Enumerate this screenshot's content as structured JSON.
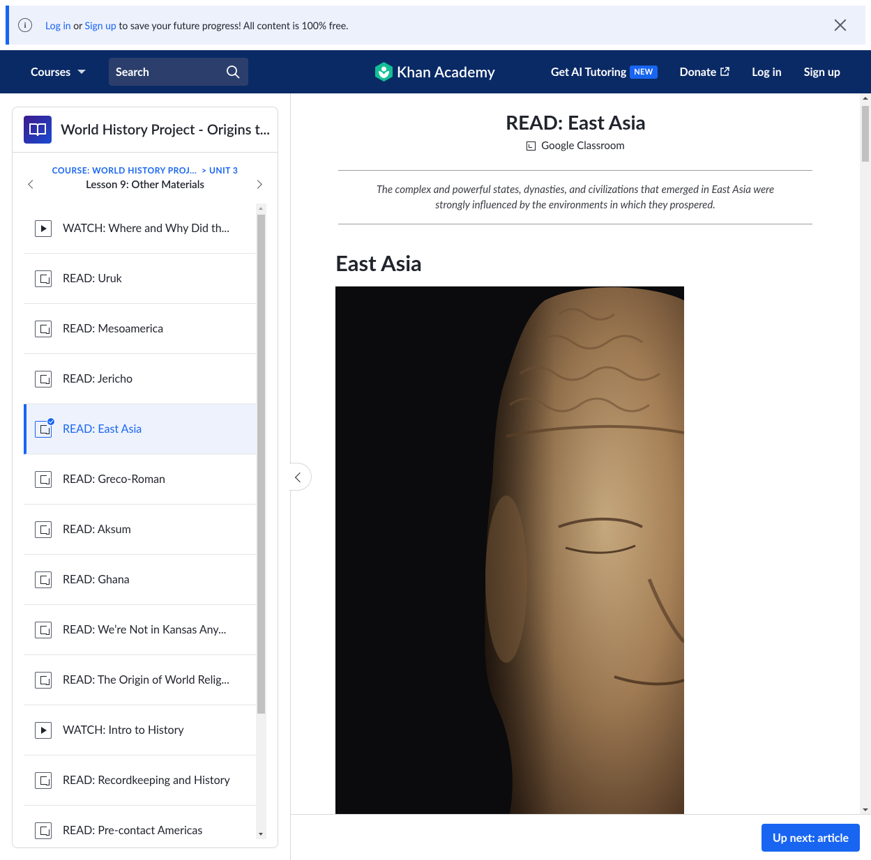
{
  "banner": {
    "login_link": "Log in",
    "or_text": " or ",
    "signup_link": "Sign up",
    "message": " to save your future progress! All content is 100% free."
  },
  "header": {
    "courses_label": "Courses",
    "search_placeholder": "Search",
    "logo_text": "Khan Academy",
    "ai_tutoring_label": "Get AI Tutoring",
    "new_badge": "NEW",
    "donate_label": "Donate",
    "login_label": "Log in",
    "signup_label": "Sign up",
    "bg_color": "#0a2a66"
  },
  "sidebar": {
    "course_title": "World History Project - Origins t...",
    "breadcrumb_course": "COURSE: WORLD HISTORY PROJ...",
    "breadcrumb_unit": "UNIT 3",
    "breadcrumb_sep": ">",
    "lesson_title": "Lesson 9: Other Materials",
    "items": [
      {
        "label": "WATCH: Where and Why Did th...",
        "icon": "video-icon",
        "active": false
      },
      {
        "label": "READ: Uruk",
        "icon": "article-icon",
        "active": false
      },
      {
        "label": "READ: Mesoamerica",
        "icon": "article-icon",
        "active": false
      },
      {
        "label": "READ: Jericho",
        "icon": "article-icon",
        "active": false
      },
      {
        "label": "READ: East Asia",
        "icon": "article-icon",
        "active": true
      },
      {
        "label": "READ: Greco-Roman",
        "icon": "article-icon",
        "active": false
      },
      {
        "label": "READ: Aksum",
        "icon": "article-icon",
        "active": false
      },
      {
        "label": "READ: Ghana",
        "icon": "article-icon",
        "active": false
      },
      {
        "label": "READ: We’re Not in Kansas Any...",
        "icon": "article-icon",
        "active": false
      },
      {
        "label": "READ: The Origin of World Relig...",
        "icon": "article-icon",
        "active": false
      },
      {
        "label": "WATCH: Intro to History",
        "icon": "video-icon",
        "active": false
      },
      {
        "label": "READ: Recordkeeping and History",
        "icon": "article-icon",
        "active": false
      },
      {
        "label": "READ: Pre-contact Americas",
        "icon": "article-icon",
        "active": false
      }
    ]
  },
  "main": {
    "title": "READ: East Asia",
    "google_classroom": "Google Classroom",
    "intro": "The complex and powerful states, dynasties, and civilizations that emerged in East Asia were strongly influenced by the environments in which they prospered.",
    "section_heading": "East Asia",
    "up_next_label": "Up next: article"
  },
  "colors": {
    "accent": "#1865f2",
    "brand_green": "#14bf96"
  }
}
